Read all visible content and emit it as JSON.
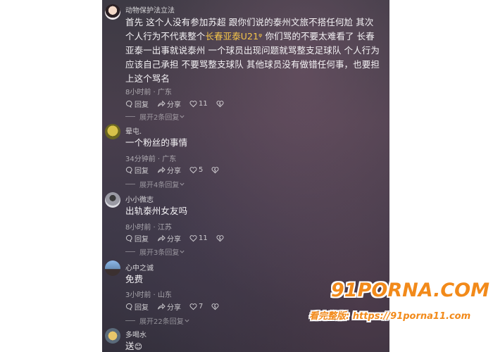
{
  "comments": [
    {
      "user": "动物保护法立法",
      "text_a": "首先 这个人没有参加苏超 跟你们说的泰州文旅不搭任何尬 其次个人行为不代表整个",
      "link": "长春亚泰U21ᵠ",
      "text_b": " 你们骂的不要太难看了 长春亚泰一出事就说泰州 一个球员出现问题就骂整支足球队 个人行为应该自己承担 不要骂整支球队 其他球员没有做错任何事，也要担上这个骂名",
      "time": "8小时前 · 广东",
      "reply": "回复",
      "share": "分享",
      "likes": "11",
      "expand": "展开2条回复"
    },
    {
      "user": "晕屯.",
      "text": "一个粉丝的事情",
      "time": "34分钟前 · 广东",
      "reply": "回复",
      "share": "分享",
      "likes": "5",
      "expand": "展开4条回复"
    },
    {
      "user": "小小微志",
      "text": "出轨泰州女友吗",
      "time": "8小时前 · 江苏",
      "reply": "回复",
      "share": "分享",
      "likes": "11",
      "expand": "展开3条回复"
    },
    {
      "user": "心中之诚",
      "text": "免费",
      "time": "3小时前 · 山东",
      "reply": "回复",
      "share": "分享",
      "likes": "7",
      "expand": "展开22条回复"
    },
    {
      "user": "多喝水",
      "text": "送",
      "emoji": "😊"
    }
  ],
  "watermark": {
    "logo": "91PORNA.COM",
    "sub": "看完整版: https://91porna11.com"
  }
}
